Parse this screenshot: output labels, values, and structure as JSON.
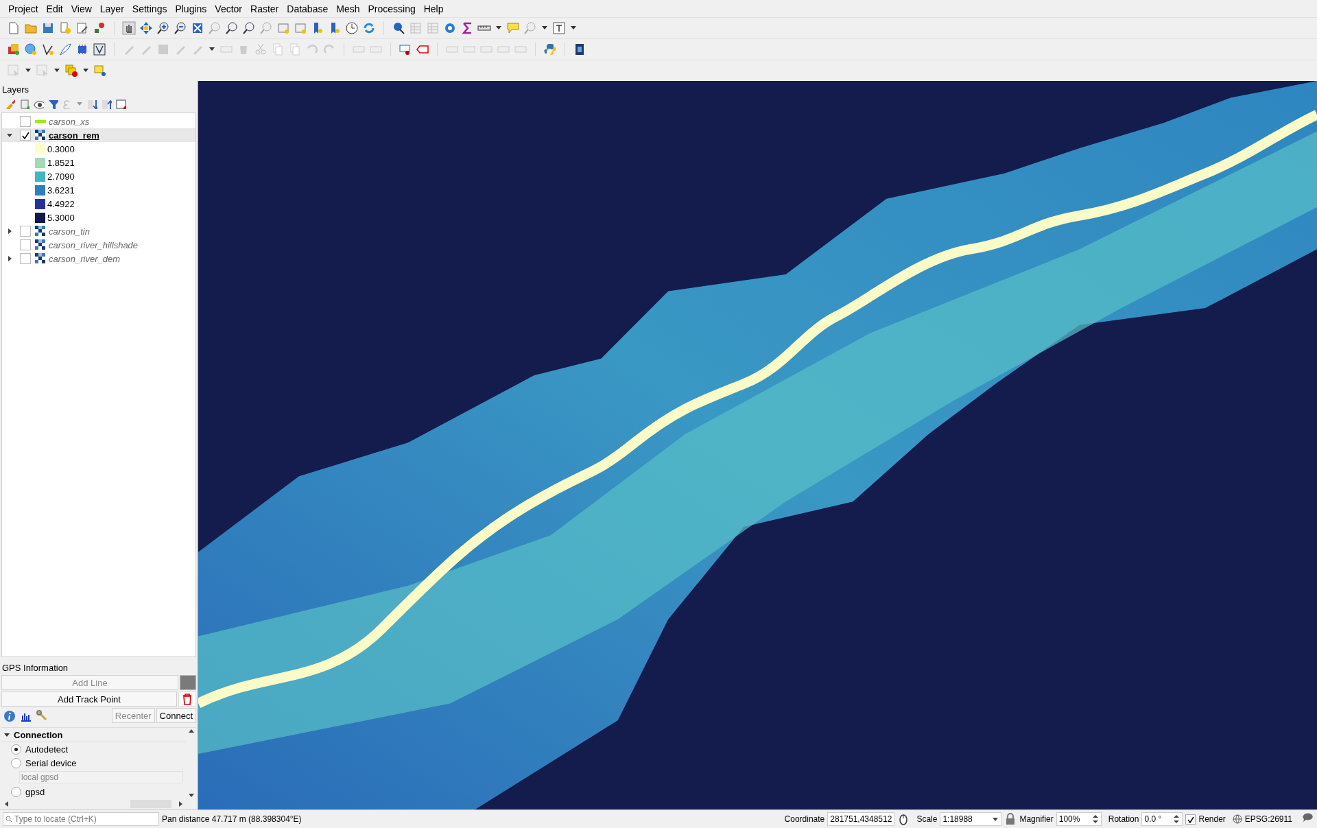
{
  "menu": [
    "Project",
    "Edit",
    "View",
    "Layer",
    "Settings",
    "Plugins",
    "Vector",
    "Raster",
    "Database",
    "Mesh",
    "Processing",
    "Help"
  ],
  "layers_panel": {
    "title": "Layers",
    "layers": [
      {
        "name": "carson_xs",
        "kind": "line",
        "checked": false,
        "selected": false,
        "color": "#99ee00"
      },
      {
        "name": "carson_rem",
        "kind": "raster",
        "checked": true,
        "selected": true,
        "expanded": true,
        "legend": [
          {
            "label": "0.3000",
            "color": "#ffffcc"
          },
          {
            "label": "1.8521",
            "color": "#a1dab4"
          },
          {
            "label": "2.7090",
            "color": "#41b6c4"
          },
          {
            "label": "3.6231",
            "color": "#2c7fb8"
          },
          {
            "label": "4.4922",
            "color": "#253494"
          },
          {
            "label": "5.3000",
            "color": "#0f1a4a"
          }
        ]
      },
      {
        "name": "carson_tin",
        "kind": "raster",
        "checked": false,
        "selected": false,
        "expanded": false
      },
      {
        "name": "carson_river_hillshade",
        "kind": "raster",
        "checked": false,
        "selected": false
      },
      {
        "name": "carson_river_dem",
        "kind": "raster",
        "checked": false,
        "selected": false,
        "expanded": false
      }
    ]
  },
  "gps_panel": {
    "title": "GPS Information",
    "add_line": {
      "label": "Add Line",
      "disabled": true
    },
    "add_track_point": {
      "label": "Add Track Point",
      "disabled": false
    },
    "recenter": {
      "label": "Recenter",
      "disabled": true
    },
    "connect": {
      "label": "Connect",
      "disabled": false
    },
    "connection": {
      "title": "Connection",
      "expanded": true,
      "options": [
        {
          "label": "Autodetect",
          "selected": true
        },
        {
          "label": "Serial device",
          "selected": false
        }
      ],
      "serial_port": {
        "placeholder": "local gpsd"
      },
      "more_options": [
        {
          "label": "gpsd",
          "selected": false
        }
      ]
    }
  },
  "status_bar": {
    "locator": {
      "placeholder": "Type to locate (Ctrl+K)"
    },
    "message": "Pan distance 47.717 m (88.398304°E)",
    "coordinate_label": "Coordinate",
    "coordinate": "281751,4348512",
    "scale_label": "Scale",
    "scale": "1:18988",
    "magnifier_label": "Magnifier",
    "magnifier": "100%",
    "rotation_label": "Rotation",
    "rotation": "0.0 °",
    "render": {
      "label": "Render",
      "checked": true
    },
    "crs": "EPSG:26911"
  }
}
